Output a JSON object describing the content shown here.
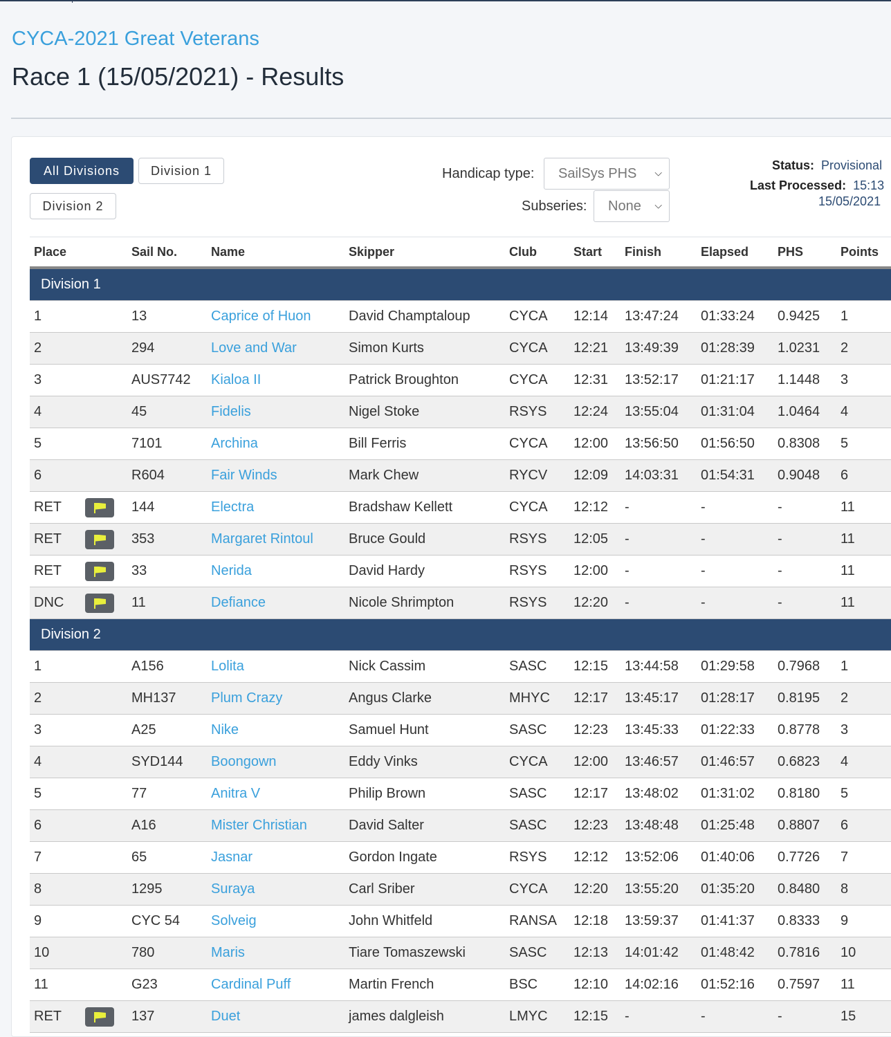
{
  "event": {
    "title": "CYCA-2021 Great Veterans"
  },
  "race": {
    "title": "Race 1 (15/05/2021) - Results"
  },
  "filters": {
    "tabs": [
      "All Divisions",
      "Division 1",
      "Division 2"
    ],
    "active_tab": "All Divisions",
    "handicap_label": "Handicap type:",
    "handicap_value": "SailSys PHS",
    "subseries_label": "Subseries:",
    "subseries_value": "None"
  },
  "status": {
    "status_label": "Status:",
    "status_value": "Provisional",
    "processed_label": "Last Processed:",
    "processed_time": "15:13",
    "processed_date": "15/05/2021"
  },
  "columns": [
    "Place",
    "Sail No.",
    "Name",
    "Skipper",
    "Club",
    "Start",
    "Finish",
    "Elapsed",
    "PHS",
    "Points"
  ],
  "colors": {
    "accent": "#3aa0dc",
    "header_bar": "#2c4b73",
    "flag": "#e9ef3c"
  },
  "divisions": [
    {
      "name": "Division 1",
      "rows": [
        {
          "place": "1",
          "flag": false,
          "sail": "13",
          "name": "Caprice of Huon",
          "skipper": "David Champtaloup",
          "club": "CYCA",
          "start": "12:14",
          "finish": "13:47:24",
          "elapsed": "01:33:24",
          "phs": "0.9425",
          "points": "1"
        },
        {
          "place": "2",
          "flag": false,
          "sail": "294",
          "name": "Love and War",
          "skipper": "Simon Kurts",
          "club": "CYCA",
          "start": "12:21",
          "finish": "13:49:39",
          "elapsed": "01:28:39",
          "phs": "1.0231",
          "points": "2"
        },
        {
          "place": "3",
          "flag": false,
          "sail": "AUS7742",
          "name": "Kialoa II",
          "skipper": "Patrick Broughton",
          "club": "CYCA",
          "start": "12:31",
          "finish": "13:52:17",
          "elapsed": "01:21:17",
          "phs": "1.1448",
          "points": "3"
        },
        {
          "place": "4",
          "flag": false,
          "sail": "45",
          "name": "Fidelis",
          "skipper": "Nigel Stoke",
          "club": "RSYS",
          "start": "12:24",
          "finish": "13:55:04",
          "elapsed": "01:31:04",
          "phs": "1.0464",
          "points": "4"
        },
        {
          "place": "5",
          "flag": false,
          "sail": "7101",
          "name": "Archina",
          "skipper": "Bill Ferris",
          "club": "CYCA",
          "start": "12:00",
          "finish": "13:56:50",
          "elapsed": "01:56:50",
          "phs": "0.8308",
          "points": "5"
        },
        {
          "place": "6",
          "flag": false,
          "sail": "R604",
          "name": "Fair Winds",
          "skipper": "Mark Chew",
          "club": "RYCV",
          "start": "12:09",
          "finish": "14:03:31",
          "elapsed": "01:54:31",
          "phs": "0.9048",
          "points": "6"
        },
        {
          "place": "RET",
          "flag": true,
          "sail": "144",
          "name": "Electra",
          "skipper": "Bradshaw Kellett",
          "club": "CYCA",
          "start": "12:12",
          "finish": "-",
          "elapsed": "-",
          "phs": "-",
          "points": "11"
        },
        {
          "place": "RET",
          "flag": true,
          "sail": "353",
          "name": "Margaret Rintoul",
          "skipper": "Bruce Gould",
          "club": "RSYS",
          "start": "12:05",
          "finish": "-",
          "elapsed": "-",
          "phs": "-",
          "points": "11"
        },
        {
          "place": "RET",
          "flag": true,
          "sail": "33",
          "name": "Nerida",
          "skipper": "David Hardy",
          "club": "RSYS",
          "start": "12:00",
          "finish": "-",
          "elapsed": "-",
          "phs": "-",
          "points": "11"
        },
        {
          "place": "DNC",
          "flag": true,
          "sail": "11",
          "name": "Defiance",
          "skipper": "Nicole Shrimpton",
          "club": "RSYS",
          "start": "12:20",
          "finish": "-",
          "elapsed": "-",
          "phs": "-",
          "points": "11"
        }
      ]
    },
    {
      "name": "Division 2",
      "rows": [
        {
          "place": "1",
          "flag": false,
          "sail": "A156",
          "name": "Lolita",
          "skipper": "Nick Cassim",
          "club": "SASC",
          "start": "12:15",
          "finish": "13:44:58",
          "elapsed": "01:29:58",
          "phs": "0.7968",
          "points": "1"
        },
        {
          "place": "2",
          "flag": false,
          "sail": "MH137",
          "name": "Plum Crazy",
          "skipper": "Angus Clarke",
          "club": "MHYC",
          "start": "12:17",
          "finish": "13:45:17",
          "elapsed": "01:28:17",
          "phs": "0.8195",
          "points": "2"
        },
        {
          "place": "3",
          "flag": false,
          "sail": "A25",
          "name": "Nike",
          "skipper": "Samuel Hunt",
          "club": "SASC",
          "start": "12:23",
          "finish": "13:45:33",
          "elapsed": "01:22:33",
          "phs": "0.8778",
          "points": "3"
        },
        {
          "place": "4",
          "flag": false,
          "sail": "SYD144",
          "name": "Boongown",
          "skipper": "Eddy Vinks",
          "club": "CYCA",
          "start": "12:00",
          "finish": "13:46:57",
          "elapsed": "01:46:57",
          "phs": "0.6823",
          "points": "4"
        },
        {
          "place": "5",
          "flag": false,
          "sail": "77",
          "name": "Anitra V",
          "skipper": "Philip Brown",
          "club": "SASC",
          "start": "12:17",
          "finish": "13:48:02",
          "elapsed": "01:31:02",
          "phs": "0.8180",
          "points": "5"
        },
        {
          "place": "6",
          "flag": false,
          "sail": "A16",
          "name": "Mister Christian",
          "skipper": "David Salter",
          "club": "SASC",
          "start": "12:23",
          "finish": "13:48:48",
          "elapsed": "01:25:48",
          "phs": "0.8807",
          "points": "6"
        },
        {
          "place": "7",
          "flag": false,
          "sail": "65",
          "name": "Jasnar",
          "skipper": "Gordon Ingate",
          "club": "RSYS",
          "start": "12:12",
          "finish": "13:52:06",
          "elapsed": "01:40:06",
          "phs": "0.7726",
          "points": "7"
        },
        {
          "place": "8",
          "flag": false,
          "sail": "1295",
          "name": "Suraya",
          "skipper": "Carl Sriber",
          "club": "CYCA",
          "start": "12:20",
          "finish": "13:55:20",
          "elapsed": "01:35:20",
          "phs": "0.8480",
          "points": "8"
        },
        {
          "place": "9",
          "flag": false,
          "sail": "CYC 54",
          "name": "Solveig",
          "skipper": "John Whitfeld",
          "club": "RANSA",
          "start": "12:18",
          "finish": "13:59:37",
          "elapsed": "01:41:37",
          "phs": "0.8333",
          "points": "9"
        },
        {
          "place": "10",
          "flag": false,
          "sail": "780",
          "name": "Maris",
          "skipper": "Tiare Tomaszewski",
          "club": "SASC",
          "start": "12:13",
          "finish": "14:01:42",
          "elapsed": "01:48:42",
          "phs": "0.7816",
          "points": "10"
        },
        {
          "place": "11",
          "flag": false,
          "sail": "G23",
          "name": "Cardinal Puff",
          "skipper": "Martin French",
          "club": "BSC",
          "start": "12:10",
          "finish": "14:02:16",
          "elapsed": "01:52:16",
          "phs": "0.7597",
          "points": "11"
        },
        {
          "place": "RET",
          "flag": true,
          "sail": "137",
          "name": "Duet",
          "skipper": "james dalgleish",
          "club": "LMYC",
          "start": "12:15",
          "finish": "-",
          "elapsed": "-",
          "phs": "-",
          "points": "15"
        }
      ]
    }
  ]
}
